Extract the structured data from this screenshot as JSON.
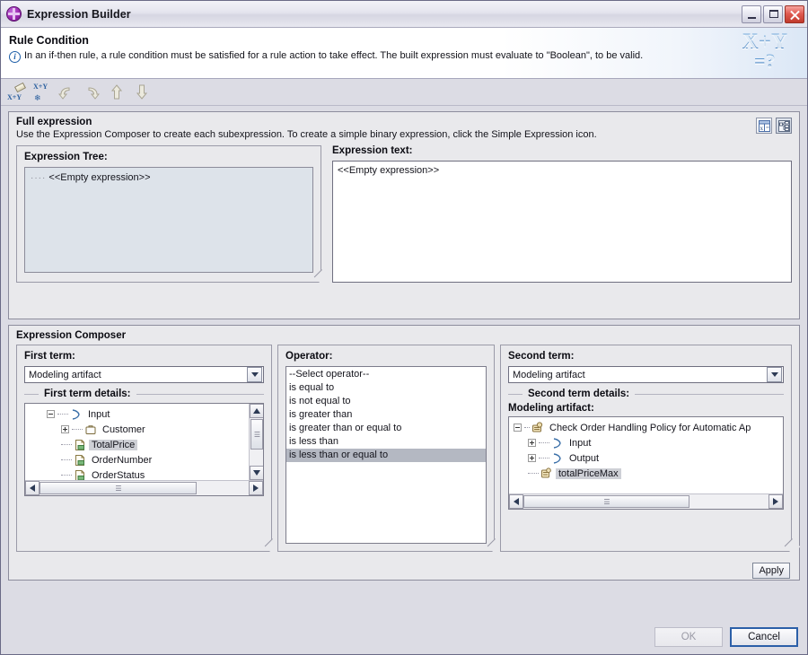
{
  "window": {
    "title": "Expression Builder",
    "app_icon": "expression-builder-icon",
    "minimize_label": "Minimize",
    "maximize_label": "Maximize",
    "close_label": "Close"
  },
  "header": {
    "title": "Rule Condition",
    "description": "In an if-then rule, a rule condition must be satisfied for a rule action to take effect. The built expression must evaluate to \"Boolean\", to be valid.",
    "info_icon": "info-icon",
    "artwork_line1": "X+Y",
    "artwork_line2": "=?"
  },
  "toolbar": {
    "items": [
      {
        "name": "clear-expression-icon",
        "label": "X+Y"
      },
      {
        "name": "freeze-expression-icon",
        "label": "X+Y"
      },
      {
        "name": "undo-icon",
        "label": "Undo"
      },
      {
        "name": "redo-icon",
        "label": "Redo"
      },
      {
        "name": "move-up-icon",
        "label": "Move Up"
      },
      {
        "name": "move-down-icon",
        "label": "Move Down"
      }
    ]
  },
  "full_expression": {
    "title": "Full expression",
    "description": "Use the Expression Composer to create each subexpression. To create a simple binary expression, click the Simple Expression icon.",
    "simple_expression_icon": "simple-expression-icon",
    "tree_expression_icon": "tree-expression-icon",
    "expression_tree_label": "Expression Tree:",
    "expression_tree_value": "<<Empty expression>>",
    "expression_text_label": "Expression text:",
    "expression_text_value": "<<Empty expression>>"
  },
  "composer": {
    "title": "Expression Composer",
    "first_term": {
      "label": "First term:",
      "combo_value": "Modeling artifact",
      "details_label": "First term details:",
      "tree": [
        {
          "label": "Input",
          "icon": "input-arrow-icon",
          "depth": 0,
          "expander": "minus",
          "selected": false
        },
        {
          "label": "Customer",
          "icon": "business-object-icon",
          "depth": 1,
          "expander": "plus",
          "selected": false
        },
        {
          "label": "TotalPrice",
          "icon": "attribute-icon",
          "depth": 1,
          "expander": "none",
          "selected": true
        },
        {
          "label": "OrderNumber",
          "icon": "attribute-icon",
          "depth": 1,
          "expander": "none",
          "selected": false
        },
        {
          "label": "OrderStatus",
          "icon": "attribute-icon",
          "depth": 1,
          "expander": "none",
          "selected": false
        }
      ]
    },
    "operator": {
      "label": "Operator:",
      "options": [
        "--Select operator--",
        "is equal to",
        "is not equal to",
        "is greater than",
        "is greater than or equal to",
        "is less than",
        "is less than or equal to"
      ],
      "selected": "is less than or equal to"
    },
    "second_term": {
      "label": "Second term:",
      "combo_value": "Modeling artifact",
      "details_label": "Second term details:",
      "artifact_label": "Modeling artifact:",
      "tree": [
        {
          "label": "Check Order Handling Policy for Automatic Ap",
          "icon": "policy-icon",
          "depth": 0,
          "expander": "minus",
          "selected": false
        },
        {
          "label": "Input",
          "icon": "input-arrow-icon",
          "depth": 1,
          "expander": "plus",
          "selected": false
        },
        {
          "label": "Output",
          "icon": "output-arrow-icon",
          "depth": 1,
          "expander": "plus",
          "selected": false
        },
        {
          "label": "totalPriceMax",
          "icon": "variable-icon",
          "depth": 1,
          "expander": "none",
          "selected": true
        }
      ]
    },
    "apply_label": "Apply"
  },
  "footer": {
    "ok_label": "OK",
    "ok_enabled": false,
    "cancel_label": "Cancel",
    "cancel_focused": true
  },
  "colors": {
    "accent_blue": "#2b5fa8",
    "selection_gray": "#b4b8c2",
    "tree_bg": "#dde3ea",
    "panel_bg": "#e9e9ec",
    "window_bg": "#dcdce4",
    "close_red": "#c0392b",
    "icon_purple": "#9c27b0"
  }
}
